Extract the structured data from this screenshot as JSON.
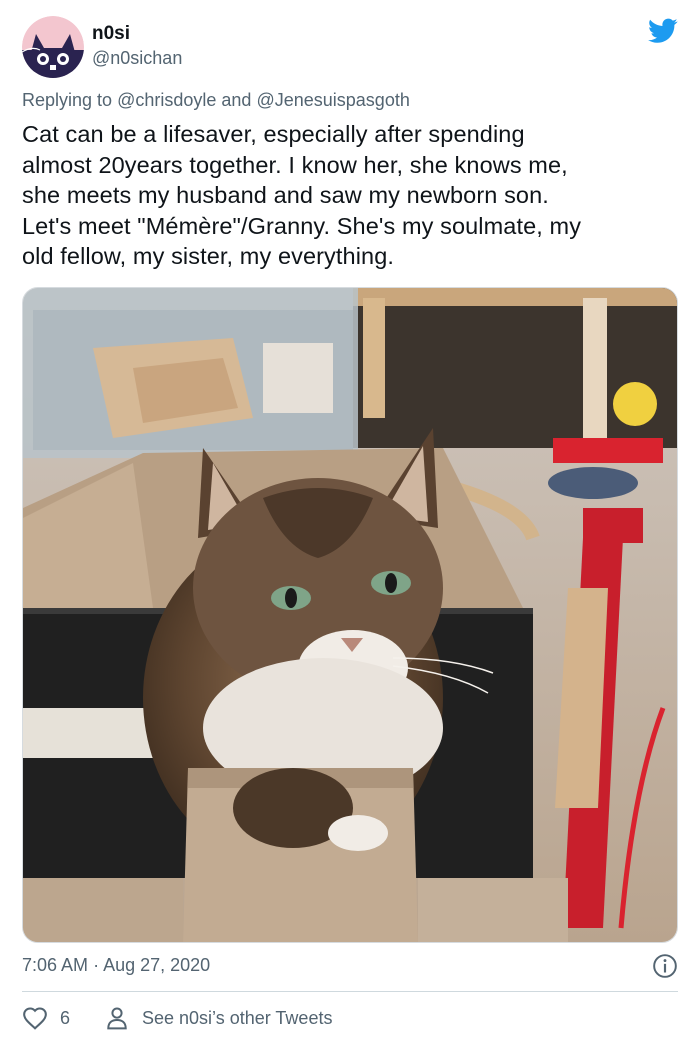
{
  "author": {
    "display_name": "n0si",
    "handle": "@n0sichan",
    "avatar_icon": "cat-avatar-icon"
  },
  "brand": {
    "logo_icon": "twitter-bird-icon",
    "color": "#1d9bf0"
  },
  "reply": {
    "prefix": "Replying to",
    "mention1": "@chrisdoyle",
    "conjunction": "and",
    "mention2": "@Jenesuispasgoth"
  },
  "tweet": {
    "lines": [
      "Cat can be a lifesaver, especially after spending",
      "almost 20years together. I know her, she knows me,",
      "she meets my husband and saw my newborn son.",
      "Let's meet \"Mémère\"/Granny. She's my soulmate, my",
      "old fellow, my sister, my everything."
    ]
  },
  "photo": {
    "subject": "long-haired tabby cat sitting in a cardboard box"
  },
  "meta": {
    "time": "7:06 AM",
    "separator": "·",
    "date": "Aug 27, 2020",
    "info_icon": "info-icon"
  },
  "actions": {
    "like_icon": "heart-icon",
    "like_count": "6",
    "profile_icon": "person-icon",
    "other_tweets_label": "See n0si’s other Tweets"
  }
}
